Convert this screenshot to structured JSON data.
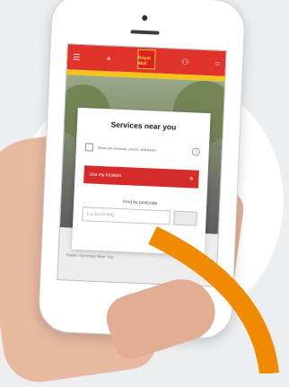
{
  "app": {
    "logo_text": "Royal Mail",
    "nav_icons": [
      "menu-icon",
      "location-pin-icon",
      "account-icon",
      "search-icon"
    ]
  },
  "card": {
    "title": "Services near you",
    "checkbox_label": "Show me services, prices, and times",
    "location_button": "Use my location",
    "find_label": "Find by postcode",
    "postcode_placeholder": "e.g. EC1V 9HQ"
  },
  "breadcrumb": "Home / Services Near You",
  "colors": {
    "brand_red": "#e0332c",
    "brand_yellow": "#f5c319",
    "accent_orange": "#f08a00"
  }
}
